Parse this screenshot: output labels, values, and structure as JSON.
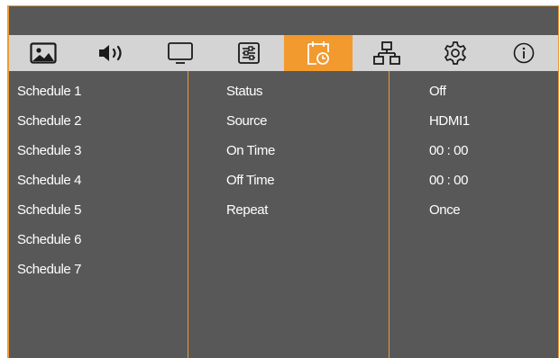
{
  "tabs": [
    {
      "id": "picture",
      "icon": "picture-icon",
      "active": false
    },
    {
      "id": "audio",
      "icon": "speaker-icon",
      "active": false
    },
    {
      "id": "screen",
      "icon": "monitor-icon",
      "active": false
    },
    {
      "id": "adjust",
      "icon": "sliders-icon",
      "active": false
    },
    {
      "id": "schedule",
      "icon": "calendar-clock-icon",
      "active": true
    },
    {
      "id": "network",
      "icon": "network-icon",
      "active": false
    },
    {
      "id": "settings",
      "icon": "gear-icon",
      "active": false
    },
    {
      "id": "info",
      "icon": "info-icon",
      "active": false
    }
  ],
  "schedules": [
    "Schedule 1",
    "Schedule 2",
    "Schedule 3",
    "Schedule 4",
    "Schedule 5",
    "Schedule 6",
    "Schedule 7"
  ],
  "settings": [
    {
      "label": "Status",
      "value": "Off"
    },
    {
      "label": "Source",
      "value": "HDMI1"
    },
    {
      "label": "On Time",
      "value": "00 : 00"
    },
    {
      "label": "Off Time",
      "value": "00 : 00"
    },
    {
      "label": "Repeat",
      "value": "Once"
    }
  ],
  "colors": {
    "accent": "#f29a2e",
    "background": "#585858",
    "tabbar": "#d4d4d4",
    "divider": "#ee9a3a",
    "text": "#ffffff"
  }
}
